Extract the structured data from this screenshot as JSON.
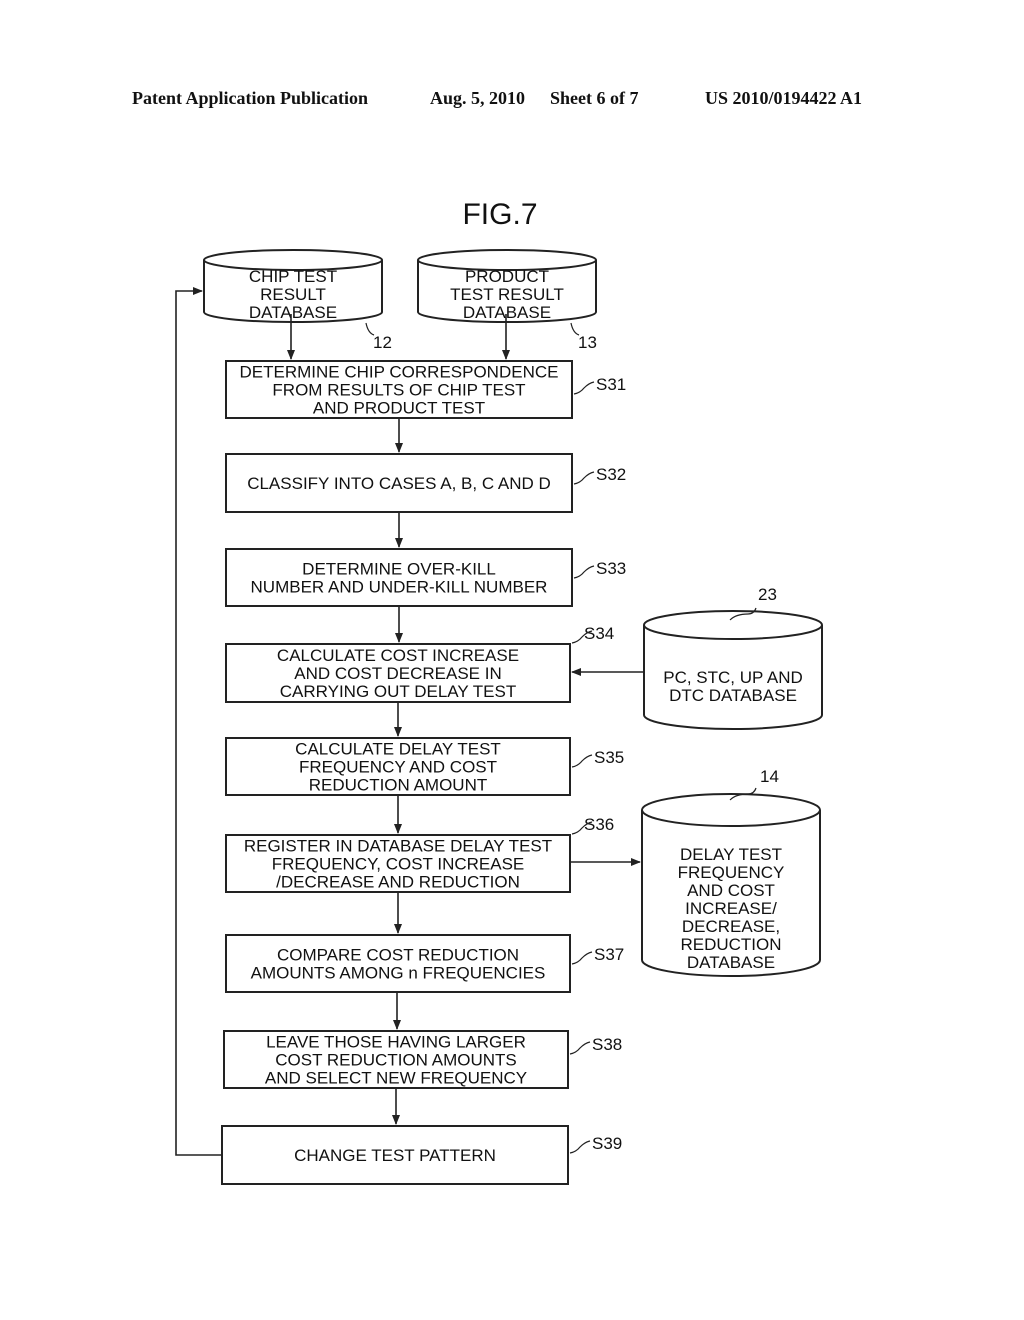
{
  "header": {
    "publication": "Patent Application Publication",
    "date": "Aug. 5, 2010",
    "sheet": "Sheet 6 of 7",
    "number": "US 2010/0194422 A1"
  },
  "figure": {
    "title": "FIG.7",
    "databases": [
      {
        "id": "chip-test-result-db",
        "ref": "12",
        "lines": [
          "CHIP TEST",
          "RESULT",
          "DATABASE"
        ]
      },
      {
        "id": "product-test-result-db",
        "ref": "13",
        "lines": [
          "PRODUCT",
          "TEST RESULT",
          "DATABASE"
        ]
      },
      {
        "id": "pc-stc-up-dtc-db",
        "ref": "23",
        "lines": [
          "PC, STC, UP AND",
          "DTC DATABASE"
        ]
      },
      {
        "id": "delay-test-frequency-db",
        "ref": "14",
        "lines": [
          "DELAY TEST",
          "FREQUENCY",
          "AND COST",
          "INCREASE/",
          "DECREASE,",
          "REDUCTION",
          "DATABASE"
        ]
      }
    ],
    "steps": [
      {
        "id": "S31",
        "label": "S31",
        "lines": [
          "DETERMINE CHIP CORRESPONDENCE",
          "FROM RESULTS OF CHIP TEST",
          "AND PRODUCT TEST"
        ]
      },
      {
        "id": "S32",
        "label": "S32",
        "lines": [
          "CLASSIFY INTO CASES A, B, C AND D"
        ]
      },
      {
        "id": "S33",
        "label": "S33",
        "lines": [
          "DETERMINE OVER-KILL",
          "NUMBER AND UNDER-KILL NUMBER"
        ]
      },
      {
        "id": "S34",
        "label": "S34",
        "lines": [
          "CALCULATE COST INCREASE",
          "AND COST DECREASE IN",
          "CARRYING OUT DELAY TEST"
        ]
      },
      {
        "id": "S35",
        "label": "S35",
        "lines": [
          "CALCULATE DELAY TEST",
          "FREQUENCY AND COST",
          "REDUCTION AMOUNT"
        ]
      },
      {
        "id": "S36",
        "label": "S36",
        "lines": [
          "REGISTER IN DATABASE DELAY TEST",
          "FREQUENCY, COST INCREASE",
          "/DECREASE AND REDUCTION"
        ]
      },
      {
        "id": "S37",
        "label": "S37",
        "lines": [
          "COMPARE COST REDUCTION",
          "AMOUNTS AMONG n FREQUENCIES"
        ]
      },
      {
        "id": "S38",
        "label": "S38",
        "lines": [
          "LEAVE THOSE HAVING LARGER",
          "COST REDUCTION AMOUNTS",
          "AND SELECT NEW FREQUENCY"
        ]
      },
      {
        "id": "S39",
        "label": "S39",
        "lines": [
          "CHANGE TEST PATTERN"
        ]
      }
    ]
  }
}
